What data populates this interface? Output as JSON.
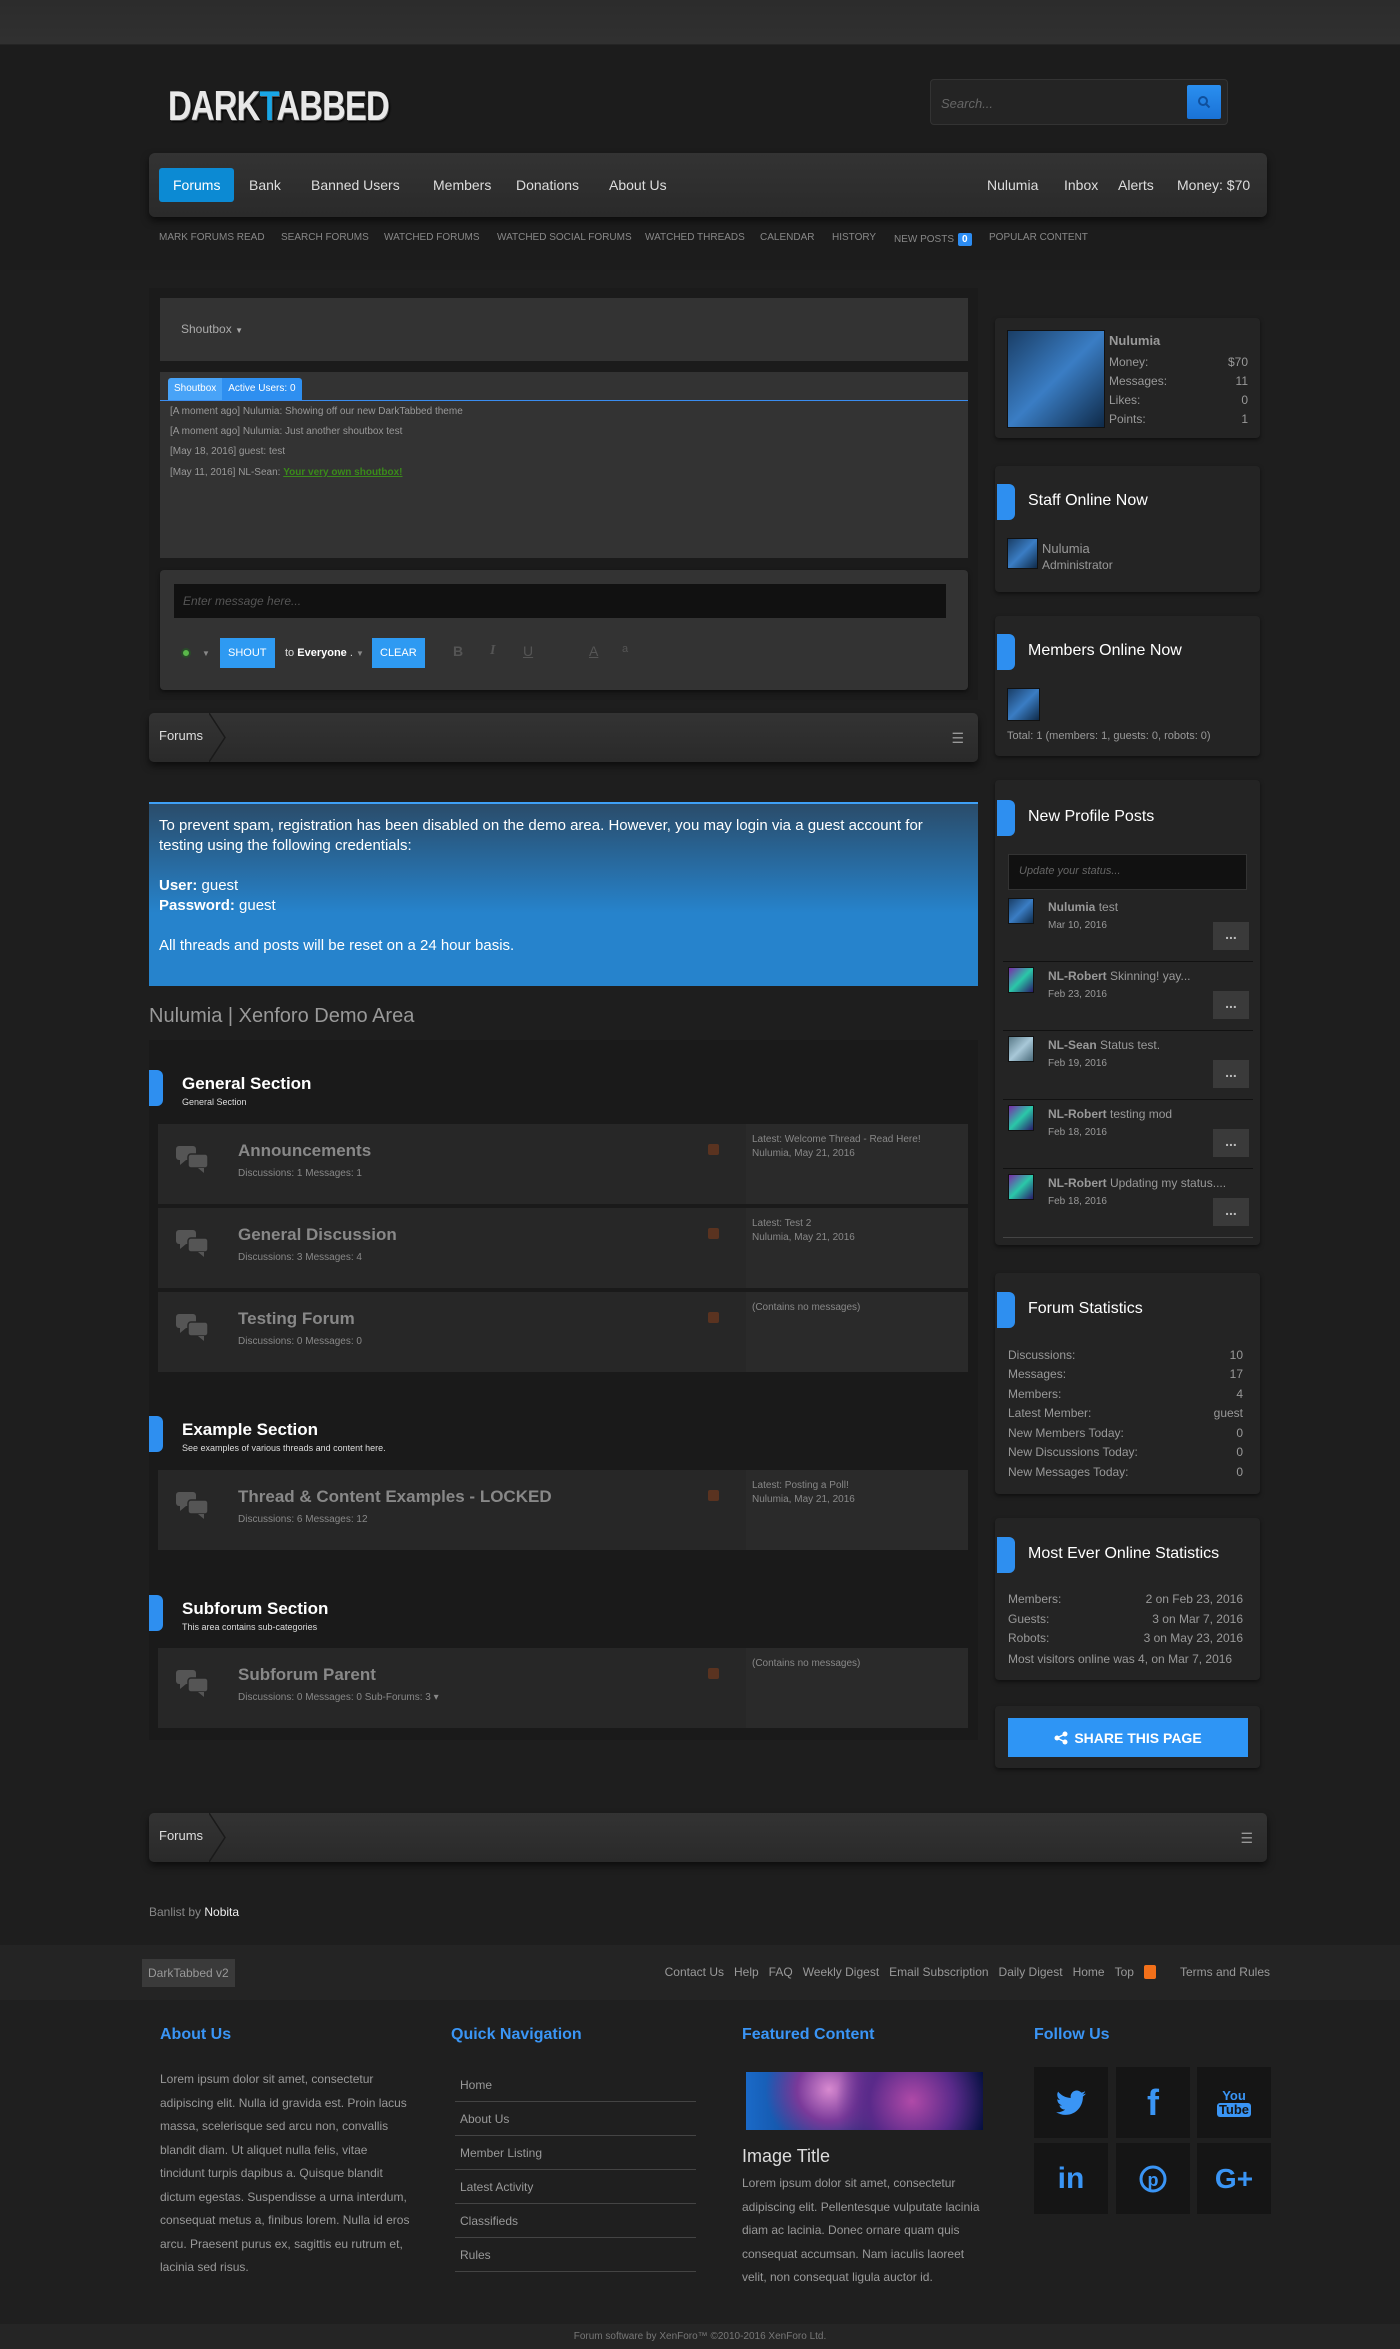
{
  "header": {
    "logo_left": "DARK",
    "logo_accent": "T",
    "logo_right": "ABBED",
    "search_placeholder": "Search..."
  },
  "nav": {
    "tabs": [
      "Forums",
      "Bank",
      "Banned Users",
      "Members",
      "Donations",
      "About Us"
    ],
    "right": [
      "Nulumia",
      "Inbox",
      "Alerts",
      "Money: $70"
    ],
    "subnav": [
      "Mark Forums Read",
      "Search Forums",
      "Watched Forums",
      "Watched Social Forums",
      "Watched Threads",
      "Calendar",
      "History",
      "New Posts",
      "Popular Content"
    ],
    "new_posts_count": "0"
  },
  "shoutbox": {
    "title": "Shoutbox",
    "tabs": [
      "Shoutbox",
      "Active Users: 0"
    ],
    "messages": [
      {
        "prefix": "[A moment ago] Nulumia: Showing off our new DarkTabbed theme",
        "link": ""
      },
      {
        "prefix": "[A moment ago] Nulumia: Just another shoutbox test",
        "link": ""
      },
      {
        "prefix": "[May 18, 2016] guest: test",
        "link": ""
      },
      {
        "prefix": "[May 11, 2016] NL-Sean: ",
        "link": "Your very own shoutbox!"
      }
    ],
    "input_placeholder": "Enter message here...",
    "shout_label": "SHOUT",
    "to_label": "to",
    "target": "Everyone",
    "clear_label": "CLEAR",
    "format_buttons": [
      "B",
      "I",
      "U",
      "A",
      "a"
    ]
  },
  "breadcrumb": {
    "label": "Forums"
  },
  "notice": {
    "line1": "To prevent spam, registration has been disabled on the demo area. However, you may login via a guest account for testing using the following credentials:",
    "user_label": "User:",
    "user_value": "guest",
    "password_label": "Password:",
    "password_value": "guest",
    "line3": "All threads and posts will be reset on a 24 hour basis."
  },
  "page_title": "Nulumia | Xenforo Demo Area",
  "sections": [
    {
      "title": "General Section",
      "desc": "General Section",
      "forums": [
        {
          "name": "Announcements",
          "stats": "Discussions: 1 Messages: 1",
          "latest": "Latest: Welcome Thread - Read Here!",
          "latest_by": "Nulumia, May 21, 2016"
        },
        {
          "name": "General Discussion",
          "stats": "Discussions: 3 Messages: 4",
          "latest": "Latest: Test 2",
          "latest_by": "Nulumia, May 21, 2016"
        },
        {
          "name": "Testing Forum",
          "stats": "Discussions: 0 Messages: 0",
          "latest": "(Contains no messages)",
          "latest_by": ""
        }
      ]
    },
    {
      "title": "Example Section",
      "desc": "See examples of various threads and content here.",
      "forums": [
        {
          "name": "Thread & Content Examples - LOCKED",
          "stats": "Discussions: 6 Messages: 12",
          "latest": "Latest: Posting a Poll!",
          "latest_by": "Nulumia, May 21, 2016"
        }
      ]
    },
    {
      "title": "Subforum Section",
      "desc": "This area contains sub-categories",
      "forums": [
        {
          "name": "Subforum Parent",
          "stats": "Discussions: 0 Messages: 0   Sub-Forums: 3 ▾",
          "latest": "(Contains no messages)",
          "latest_by": ""
        }
      ]
    }
  ],
  "sidebar": {
    "profile": {
      "name": "Nulumia",
      "stats": [
        {
          "label": "Money:",
          "value": "$70"
        },
        {
          "label": "Messages:",
          "value": "11"
        },
        {
          "label": "Likes:",
          "value": "0"
        },
        {
          "label": "Points:",
          "value": "1"
        }
      ]
    },
    "staff": {
      "title": "Staff Online Now",
      "name": "Nulumia",
      "role": "Administrator"
    },
    "members_online": {
      "title": "Members Online Now",
      "total": "Total: 1 (members: 1, guests: 0, robots: 0)"
    },
    "profile_posts": {
      "title": "New Profile Posts",
      "placeholder": "Update your status...",
      "posts": [
        {
          "user": "Nulumia",
          "text": "test",
          "date": "Mar 10, 2016"
        },
        {
          "user": "NL-Robert",
          "text": "Skinning! yay...",
          "date": "Feb 23, 2016"
        },
        {
          "user": "NL-Sean",
          "text": "Status test.",
          "date": "Feb 19, 2016"
        },
        {
          "user": "NL-Robert",
          "text": "testing mod",
          "date": "Feb 18, 2016"
        },
        {
          "user": "NL-Robert",
          "text": "Updating my status....",
          "date": "Feb 18, 2016"
        }
      ],
      "more_label": "..."
    },
    "forum_stats": {
      "title": "Forum Statistics",
      "rows": [
        {
          "label": "Discussions:",
          "value": "10"
        },
        {
          "label": "Messages:",
          "value": "17"
        },
        {
          "label": "Members:",
          "value": "4"
        },
        {
          "label": "Latest Member:",
          "value": "guest"
        },
        {
          "label": "New Members Today:",
          "value": "0"
        },
        {
          "label": "New Discussions Today:",
          "value": "0"
        },
        {
          "label": "New Messages Today:",
          "value": "0"
        }
      ]
    },
    "most_online": {
      "title": "Most Ever Online Statistics",
      "rows": [
        {
          "label": "Members:",
          "value": "2 on Feb 23, 2016"
        },
        {
          "label": "Guests:",
          "value": "3 on Mar 7, 2016"
        },
        {
          "label": "Robots:",
          "value": "3 on May 23, 2016"
        }
      ],
      "note": "Most visitors online was 4, on Mar 7, 2016"
    },
    "share_label": "SHARE THIS PAGE"
  },
  "footer": {
    "credits_prefix": "Banlist by",
    "credits_name": "Nobita",
    "version": "DarkTabbed v2",
    "links": [
      "Contact Us",
      "Help",
      "FAQ",
      "Weekly Digest",
      "Email Subscription",
      "Daily Digest",
      "Home",
      "Top"
    ],
    "terms": "Terms and Rules",
    "about_title": "About Us",
    "about_text": "Lorem ipsum dolor sit amet, consectetur adipiscing elit. Nulla id gravida est. Proin lacus massa, scelerisque sed arcu non, convallis blandit diam. Ut aliquet nulla felis, vitae tincidunt turpis dapibus a. Quisque blandit dictum egestas. Suspendisse a urna interdum, consequat metus a, finibus lorem. Nulla id eros arcu. Praesent purus ex, sagittis eu rutrum et, lacinia sed risus.",
    "quicknav_title": "Quick Navigation",
    "quicknav": [
      "Home",
      "About Us",
      "Member Listing",
      "Latest Activity",
      "Classifieds",
      "Rules"
    ],
    "featured_title": "Featured Content",
    "featured_image_title": "Image Title",
    "featured_text": "Lorem ipsum dolor sit amet, consectetur adipiscing elit. Pellentesque vulputate lacinia diam ac lacinia. Donec ornare quam quis consequat accumsan. Nam iaculis laoreet velit, non consequat ligula auctor id.",
    "follow_title": "Follow Us",
    "social": [
      "twitter",
      "facebook",
      "youtube",
      "linkedin",
      "pinterest",
      "google-plus"
    ],
    "copyright": "Forum software by XenForo™ ©2010-2016 XenForo Ltd."
  },
  "colors": {
    "accent": "#2e8ff0",
    "nav_active": "#0c8ad3",
    "link_green": "#3a8a1a"
  }
}
